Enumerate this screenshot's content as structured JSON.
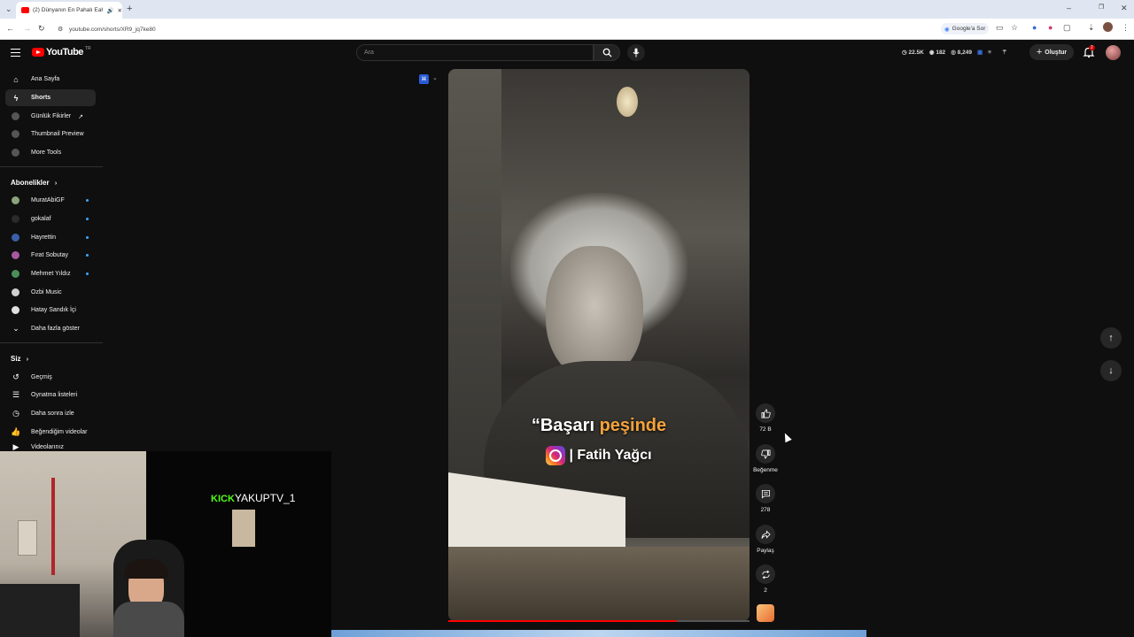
{
  "browser": {
    "tab_title": "(2) Dünyanın En Pahalı Eahu...",
    "url": "youtube.com/shorts/XR9_jq7ke80",
    "google_sor": "Google'a Sor"
  },
  "header": {
    "logo_text": "YouTube",
    "logo_country": "TR",
    "search_placeholder": "Ara",
    "stats": [
      "22.5K",
      "182",
      "8,249"
    ],
    "create_label": "Oluştur",
    "notification_count": "2"
  },
  "sidebar": {
    "primary": [
      {
        "label": "Ana Sayfa",
        "icon": "home-icon"
      },
      {
        "label": "Shorts",
        "icon": "shorts-icon",
        "active": true
      },
      {
        "label": "Günlük Fikirler",
        "icon": "ext-icon"
      },
      {
        "label": "Thumbnail Preview",
        "icon": "ext-icon"
      },
      {
        "label": "More Tools",
        "icon": "ext-icon"
      }
    ],
    "subscriptions_title": "Abonelikler",
    "subscriptions": [
      {
        "label": "MuratAbiGF",
        "color": "#8aa37b",
        "new": true
      },
      {
        "label": "gokalaf",
        "color": "#2b2b2b",
        "new": true
      },
      {
        "label": "Hayrettin",
        "color": "#3a5ea8",
        "new": true
      },
      {
        "label": "Fırat Sobutay",
        "color": "#a8589e",
        "new": true
      },
      {
        "label": "Mehmet Yıldız",
        "color": "#4a8f5a",
        "new": true
      },
      {
        "label": "Ozbi Music",
        "color": "#d0d0d0",
        "new": false
      },
      {
        "label": "Hatay Sandık İçi",
        "color": "#e0e0e0",
        "new": false
      }
    ],
    "show_more": "Daha fazla göster",
    "you_title": "Siz",
    "you_items": [
      {
        "label": "Geçmiş",
        "icon": "history-icon"
      },
      {
        "label": "Oynatma listeleri",
        "icon": "playlist-icon"
      },
      {
        "label": "Daha sonra izle",
        "icon": "clock-icon"
      },
      {
        "label": "Beğendiğim videolar",
        "icon": "thumb-up-icon"
      },
      {
        "label": "Videolarınız",
        "icon": "video-icon"
      }
    ]
  },
  "video": {
    "caption_line1_a": "“Başarı",
    "caption_line1_b": "peşinde",
    "caption_line2": "| Fatih Yağcı",
    "progress": 0.76
  },
  "actions": {
    "like_count": "72 B",
    "dislike_label": "Beğenme",
    "comment_count": "278",
    "share_label": "Paylaş",
    "remix_count": "2"
  },
  "stream": {
    "kick_prefix": "KICK",
    "channel": "YAKUPTV_1"
  },
  "colors": {
    "accent_red": "#ff0000",
    "caption_orange": "#f5a23c",
    "kick_green": "#53fc18"
  }
}
